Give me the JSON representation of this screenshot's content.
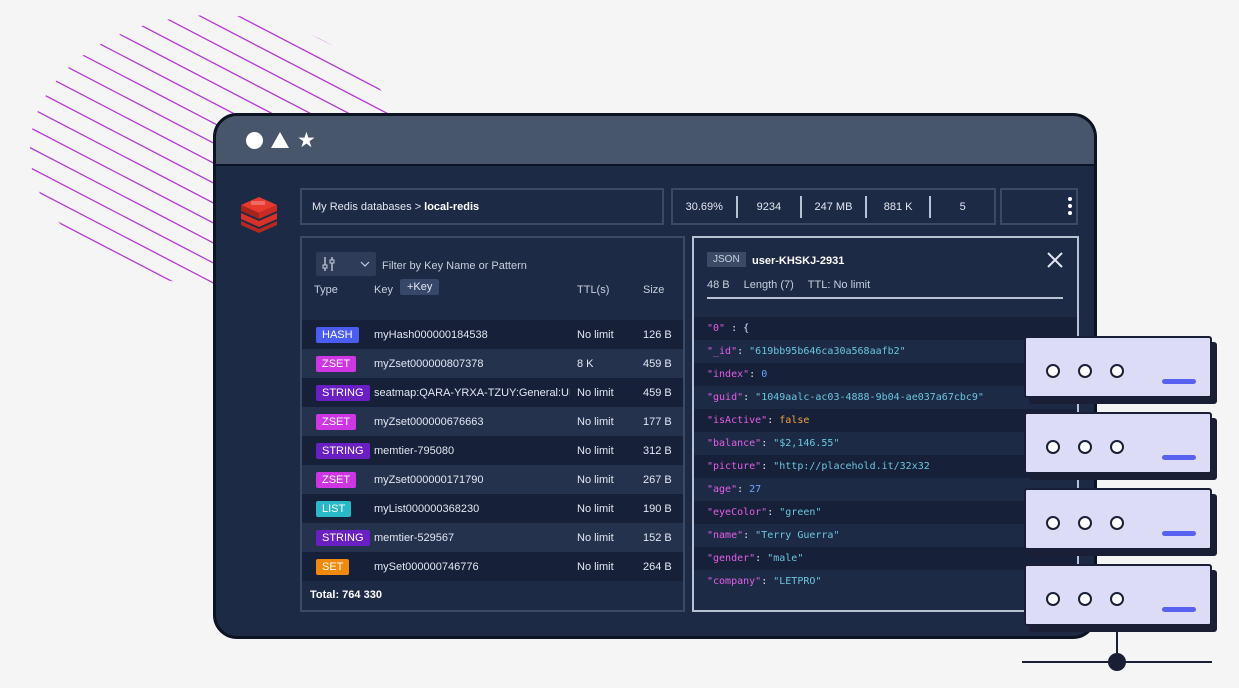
{
  "breadcrumb": {
    "parent": "My Redis databases >",
    "current": "local-redis"
  },
  "stats": [
    "30.69%",
    "9234",
    "247 MB",
    "881 K",
    "5"
  ],
  "keys": {
    "filter_placeholder": "Filter by Key Name or Pattern",
    "headers": {
      "type": "Type",
      "key": "Key",
      "ttl": "TTL(s)",
      "size": "Size"
    },
    "add_key_label": "+Key",
    "rows": [
      {
        "type": "HASH",
        "key": "myHash000000184538",
        "ttl": "No limit",
        "size": "126 B"
      },
      {
        "type": "ZSET",
        "key": "myZset000000807378",
        "ttl": "8 K",
        "size": "459 B"
      },
      {
        "type": "STRING",
        "key": "seatmap:QARA-YRXA-TZUY:General:UF",
        "ttl": "No limit",
        "size": "459 B"
      },
      {
        "type": "ZSET",
        "key": "myZset000000676663",
        "ttl": "No limit",
        "size": "177 B"
      },
      {
        "type": "STRING",
        "key": "memtier-795080",
        "ttl": "No limit",
        "size": "312 B"
      },
      {
        "type": "ZSET",
        "key": "myZset000000171790",
        "ttl": "No limit",
        "size": "267 B"
      },
      {
        "type": "LIST",
        "key": "myList000000368230",
        "ttl": "No limit",
        "size": "190 B"
      },
      {
        "type": "STRING",
        "key": "memtier-529567",
        "ttl": "No limit",
        "size": "152 B"
      },
      {
        "type": "SET",
        "key": "mySet000000746776",
        "ttl": "No limit",
        "size": "264 B"
      }
    ],
    "total": "Total: 764 330"
  },
  "type_colors": {
    "HASH": "#4b5df0",
    "ZSET": "#cf36e3",
    "STRING": "#6a1fc2",
    "LIST": "#2ab9c9",
    "SET": "#f08a0f"
  },
  "detail": {
    "format": "JSON",
    "key_name": "user-KHSKJ-2931",
    "size": "48 B",
    "length": "Length (7)",
    "ttl": "TTL: No limit",
    "lines": [
      {
        "k": "\"0\"",
        "sep": " : ",
        "v": "{",
        "t": "p"
      },
      {
        "k": "\"_id\"",
        "sep": ": ",
        "v": "\"619bb95b646ca30a568aafb2\"",
        "t": "s"
      },
      {
        "k": "\"index\"",
        "sep": ": ",
        "v": "0",
        "t": "n"
      },
      {
        "k": "\"guid\"",
        "sep": ": ",
        "v": "\"1049aalc-ac03-4888-9b04-ae037a67cbc9\"",
        "t": "s"
      },
      {
        "k": "\"isActive\"",
        "sep": ": ",
        "v": "false",
        "t": "b"
      },
      {
        "k": "\"balance\"",
        "sep": ": ",
        "v": "\"$2,146.55\"",
        "t": "s"
      },
      {
        "k": "\"picture\"",
        "sep": ": ",
        "v": "\"http://placehold.it/32x32",
        "t": "s"
      },
      {
        "k": "\"age\"",
        "sep": ": ",
        "v": "27",
        "t": "n"
      },
      {
        "k": "\"eyeColor\"",
        "sep": ": ",
        "v": "\"green\"",
        "t": "s"
      },
      {
        "k": "\"name\"",
        "sep": ": ",
        "v": "\"Terry Guerra\"",
        "t": "s"
      },
      {
        "k": "\"gender\"",
        "sep": ": ",
        "v": "\"male\"",
        "t": "s"
      },
      {
        "k": "\"company\"",
        "sep": ": ",
        "v": "\"LETPRO\"",
        "t": "s"
      }
    ]
  },
  "icons": {
    "window_controls": [
      "circle-icon",
      "triangle-icon",
      "star-icon"
    ],
    "logo": "redis-logo-icon",
    "close": "close-icon",
    "menu": "kebab-menu-icon",
    "filter": "filter-sliders-icon"
  },
  "servers": 4
}
